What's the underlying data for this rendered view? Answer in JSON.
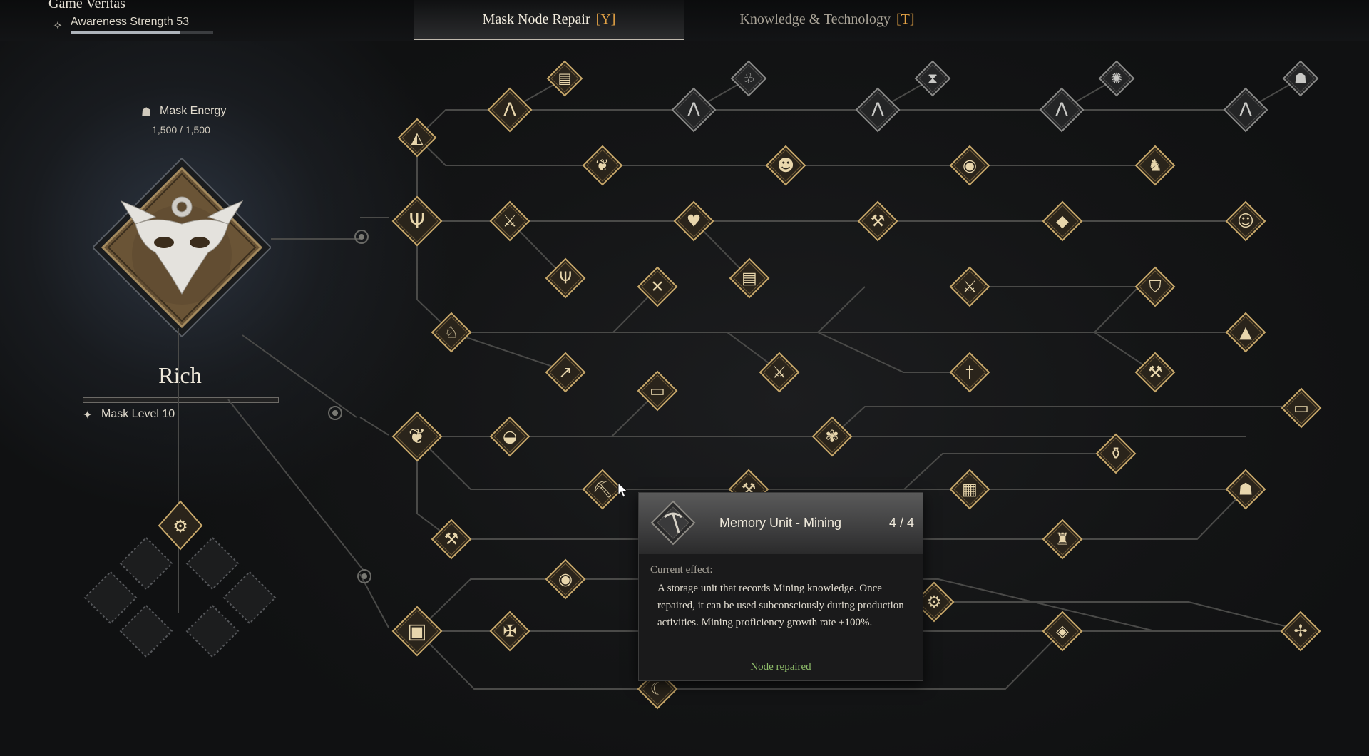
{
  "header": {
    "character_name": "Game Veritas",
    "awareness_label": "Awareness Strength 53",
    "awareness_icon": "awareness-icon",
    "awareness_progress": 0.77
  },
  "tabs": [
    {
      "label": "Mask Node Repair",
      "hotkey": "[Y]",
      "active": true
    },
    {
      "label": "Knowledge & Technology",
      "hotkey": "[T]",
      "active": false
    }
  ],
  "left_panel": {
    "energy_label": "Mask Energy",
    "energy_value": "1,500 / 1,500",
    "mask_name": "Rich",
    "level_label": "Mask Level 10",
    "level_progress": 0.0
  },
  "tooltip": {
    "title": "Memory Unit - Mining",
    "count": "4 / 4",
    "effect_label": "Current effect:",
    "description": "A storage unit that records Mining knowledge. Once repaired, it can be used subconsciously during production activities. Mining proficiency growth rate +100%.",
    "status": "Node repaired"
  },
  "colors": {
    "accent_orange": "#e3a245",
    "node_gold": "#c8a86a",
    "repaired_green": "#8fbd6a"
  }
}
